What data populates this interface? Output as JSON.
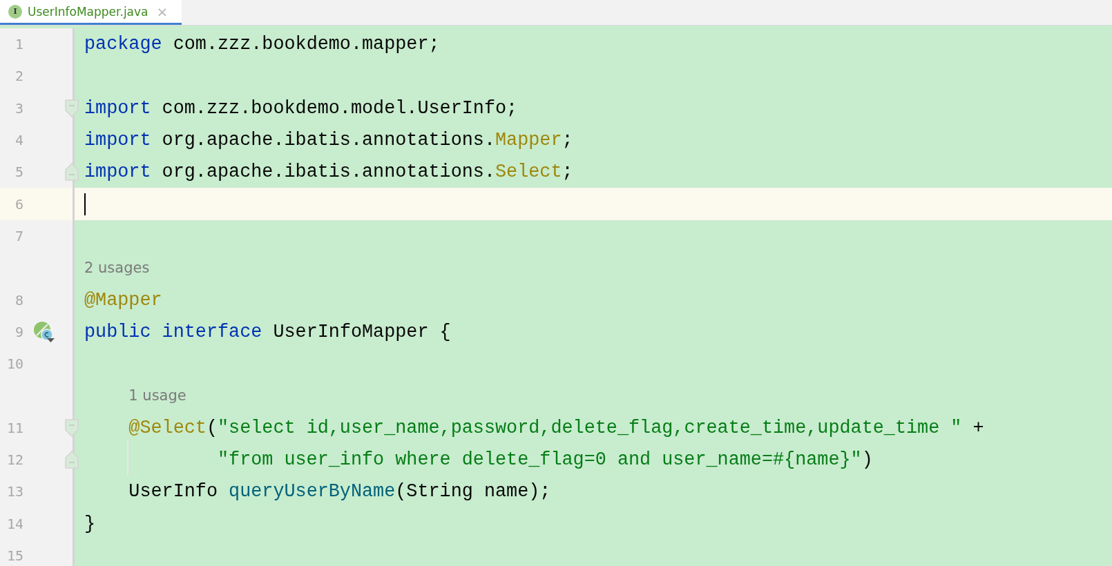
{
  "tabs": [
    {
      "icon_letter": "I",
      "label": "UserInfoMapper.java",
      "close": "×",
      "selected": true
    }
  ],
  "lines": [
    {
      "kind": "code",
      "number": "1",
      "tokens": [
        {
          "kind": "keyword",
          "text": "package"
        },
        {
          "kind": "plain",
          "text": " com.zzz.bookdemo.mapper;"
        }
      ]
    },
    {
      "kind": "code",
      "number": "2"
    },
    {
      "kind": "code",
      "number": "3",
      "fold_start": true,
      "tokens": [
        {
          "kind": "keyword",
          "text": "import"
        },
        {
          "kind": "plain",
          "text": " com.zzz.bookdemo.model.UserInfo;"
        }
      ]
    },
    {
      "kind": "code",
      "number": "4",
      "tokens": [
        {
          "kind": "keyword",
          "text": "import"
        },
        {
          "kind": "plain",
          "text": " org.apache.ibatis.annotations."
        },
        {
          "kind": "annotation",
          "text": "Mapper"
        },
        {
          "kind": "plain",
          "text": ";"
        }
      ]
    },
    {
      "kind": "code",
      "number": "5",
      "fold_end": true,
      "tokens": [
        {
          "kind": "keyword",
          "text": "import"
        },
        {
          "kind": "plain",
          "text": " org.apache.ibatis.annotations."
        },
        {
          "kind": "annotation",
          "text": "Select"
        },
        {
          "kind": "plain",
          "text": ";"
        }
      ]
    },
    {
      "kind": "code",
      "number": "6",
      "current": true
    },
    {
      "kind": "code",
      "number": "7"
    },
    {
      "kind": "hint",
      "text": "2 usages"
    },
    {
      "kind": "code",
      "number": "8",
      "tokens": [
        {
          "kind": "annotation",
          "text": "@Mapper"
        }
      ]
    },
    {
      "kind": "code",
      "number": "9",
      "implemented": true,
      "tokens": [
        {
          "kind": "keyword",
          "text": "public"
        },
        {
          "kind": "keyword",
          "text": " interface"
        },
        {
          "kind": "plain",
          "text": " UserInfoMapper {"
        }
      ]
    },
    {
      "kind": "code",
      "number": "10"
    },
    {
      "kind": "hint",
      "text": "1 usage"
    },
    {
      "kind": "code",
      "number": "11",
      "fold_start": true,
      "tokens": [
        {
          "kind": "annotation",
          "text": "    @Select"
        },
        {
          "kind": "plain",
          "text": "("
        },
        {
          "kind": "string",
          "text": "\"select id,user_name,password,delete_flag,create_time,update_time \""
        },
        {
          "kind": "plain",
          "text": " +"
        }
      ]
    },
    {
      "kind": "code",
      "number": "12",
      "fold_end": true,
      "indent_guide": true,
      "tokens": [
        {
          "kind": "string",
          "text": "            \"from user_info where delete_flag=0 and user_name=#{name}\""
        },
        {
          "kind": "plain",
          "text": ")"
        }
      ]
    },
    {
      "kind": "code",
      "number": "13",
      "tokens": [
        {
          "kind": "plain",
          "text": "    UserInfo "
        },
        {
          "kind": "method",
          "text": "queryUserByName"
        },
        {
          "kind": "plain",
          "text": "(String name);"
        }
      ]
    },
    {
      "kind": "code",
      "number": "14",
      "tokens": [
        {
          "kind": "plain",
          "text": "}"
        }
      ]
    },
    {
      "kind": "code",
      "number": "15"
    }
  ]
}
